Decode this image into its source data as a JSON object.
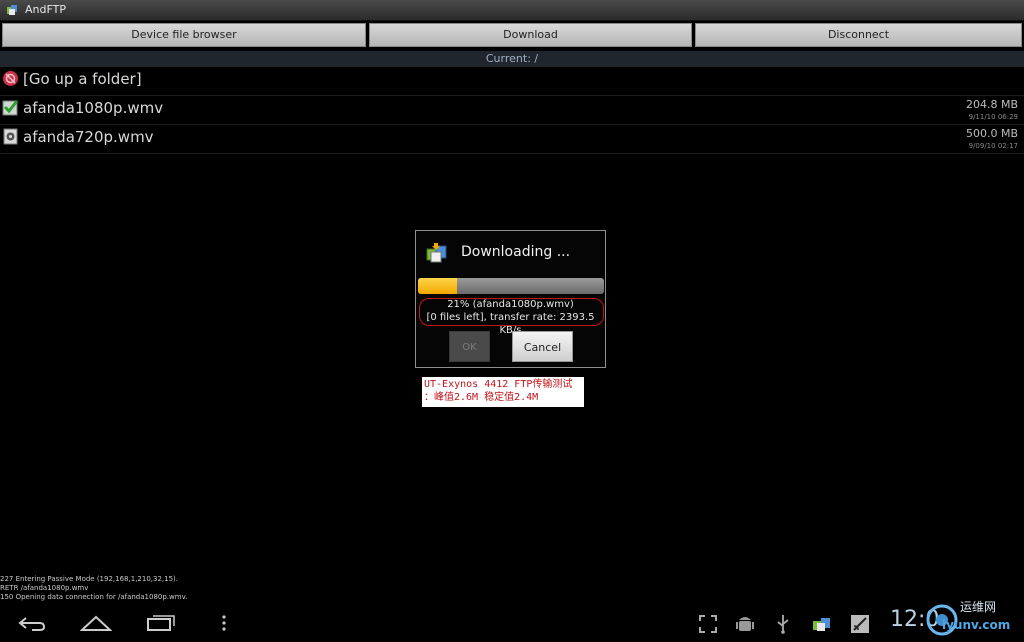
{
  "window": {
    "title": "AndFTP"
  },
  "toolbar": {
    "device_browser": "Device file browser",
    "download": "Download",
    "disconnect": "Disconnect"
  },
  "current_path": "Current: /",
  "files": [
    {
      "name": "[Go up a folder]",
      "size": "",
      "date": "",
      "icon": "up-folder-icon"
    },
    {
      "name": "afanda1080p.wmv",
      "size": "204.8 MB",
      "date": "9/11/10 06:29",
      "icon": "checked-file-icon"
    },
    {
      "name": "afanda720p.wmv",
      "size": "500.0 MB",
      "date": "9/09/10 02:17",
      "icon": "video-file-icon"
    }
  ],
  "dialog": {
    "title": "Downloading ...",
    "progress": 0.21,
    "line1": "21% (afanda1080p.wmv)",
    "line2": "[0 files left], transfer rate: 2393.5 KB/s",
    "ok_label": "OK",
    "cancel_label": "Cancel"
  },
  "caption": {
    "line1": "UT-Exynos 4412 FTP传输测试",
    "line2": "：峰值2.6M   稳定值2.4M"
  },
  "log": [
    "227 Entering Passive Mode (192,168,1,210,32,15).",
    "RETR /afanda1080p.wmv",
    "150 Opening data connection for /afanda1080p.wmv."
  ],
  "status": {
    "clock": "12:0"
  },
  "watermark": {
    "text1": "运维网",
    "text2": "iyunv.com"
  },
  "colors": {
    "progress_fill": "#f2a800",
    "highlight": "#c0141a"
  }
}
